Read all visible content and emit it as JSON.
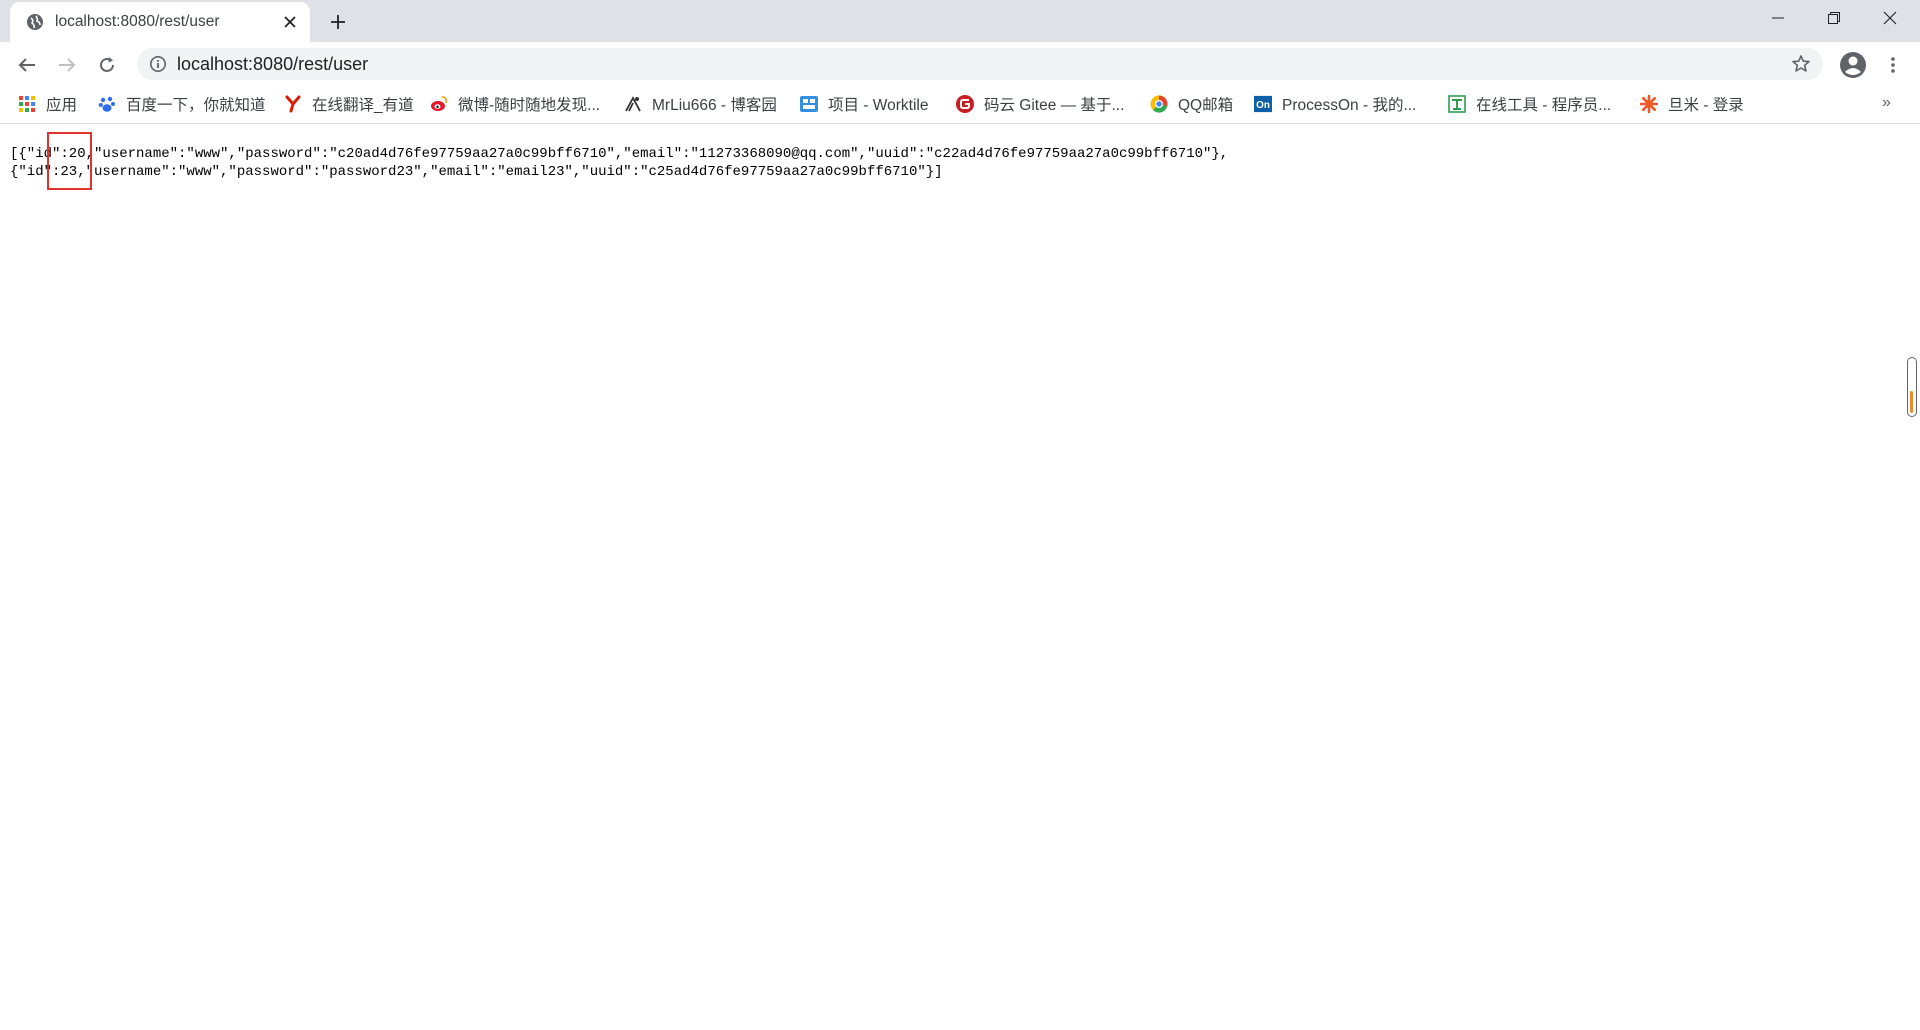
{
  "tab": {
    "title": "localhost:8080/rest/user"
  },
  "address_bar": {
    "url": "localhost:8080/rest/user"
  },
  "bookmarks": [
    {
      "label": "应用",
      "icon": "apps-grid-icon"
    },
    {
      "label": "百度一下，你就知道",
      "icon": "baidu-paw-icon"
    },
    {
      "label": "在线翻译_有道",
      "icon": "youdao-icon"
    },
    {
      "label": "微博-随时随地发现...",
      "icon": "weibo-icon"
    },
    {
      "label": "MrLiu666 - 博客园",
      "icon": "cnblogs-icon"
    },
    {
      "label": "项目 - Worktile",
      "icon": "worktile-icon"
    },
    {
      "label": "码云 Gitee — 基于...",
      "icon": "gitee-icon"
    },
    {
      "label": "QQ邮箱",
      "icon": "qqmail-icon"
    },
    {
      "label": "ProcessOn - 我的...",
      "icon": "processon-icon"
    },
    {
      "label": "在线工具 - 程序员...",
      "icon": "tool-icon"
    },
    {
      "label": "旦米 - 登录",
      "icon": "danmi-icon"
    }
  ],
  "bookmarks_overflow": "»",
  "content": {
    "lines": [
      "[{\"id\":20,\"username\":\"www\",\"password\":\"c20ad4d76fe97759aa27a0c99bff6710\",\"email\":\"11273368090@qq.com\",\"uuid\":\"c22ad4d76fe97759aa27a0c99bff6710\"},",
      "{\"id\":23,\"username\":\"www\",\"password\":\"password23\",\"email\":\"email23\",\"uuid\":\"c25ad4d76fe97759aa27a0c99bff6710\"}]"
    ]
  },
  "colors": {
    "tabstrip_bg": "#dee1e6",
    "omnibox_bg": "#f1f3f4",
    "highlight_border": "#e0322b"
  }
}
